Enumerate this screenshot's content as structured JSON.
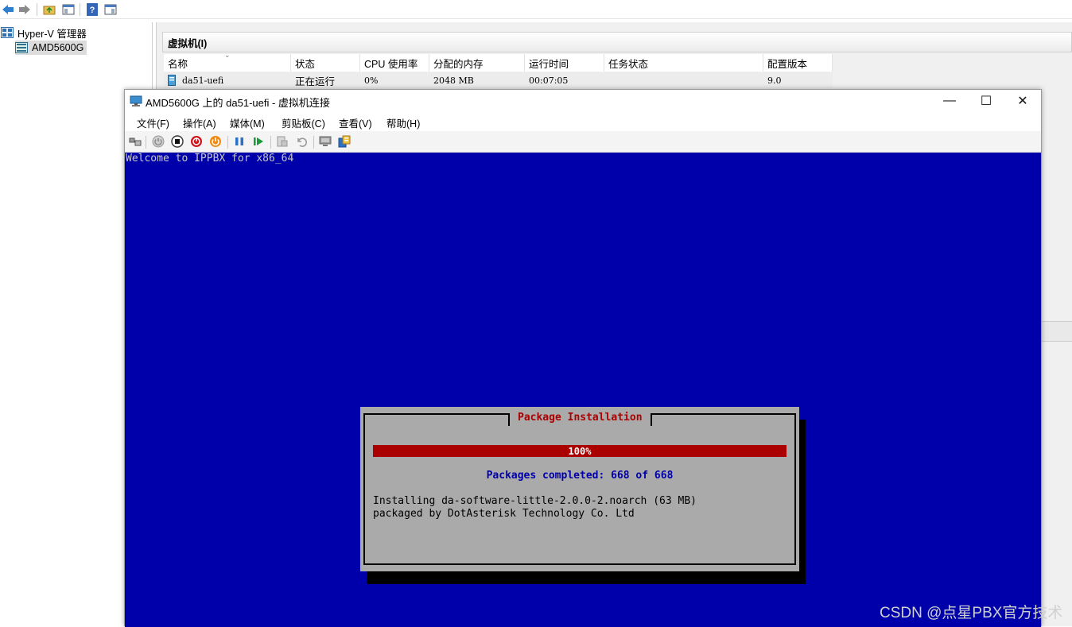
{
  "manager": {
    "tree": {
      "root_label": "Hyper-V 管理器",
      "child_label": "AMD5600G"
    },
    "vm_section_title": "虚拟机(I)",
    "columns": [
      {
        "label": "名称"
      },
      {
        "label": "状态"
      },
      {
        "label": "CPU 使用率"
      },
      {
        "label": "分配的内存"
      },
      {
        "label": "运行时间"
      },
      {
        "label": "任务状态"
      },
      {
        "label": "配置版本"
      }
    ],
    "vm_row": {
      "name": "da51-uefi",
      "state": "正在运行",
      "cpu": "0%",
      "memory": "2048 MB",
      "uptime": "00:07:05",
      "task": "",
      "version": "9.0"
    },
    "toolbar_icons": [
      "back-arrow-icon",
      "forward-arrow-icon",
      "folder-up-icon",
      "show-hide-pane-icon",
      "help-icon",
      "action-pane-icon"
    ]
  },
  "vm_window": {
    "title": "AMD5600G 上的 da51-uefi - 虚拟机连接",
    "controls": {
      "minimize": "—",
      "maximize": "☐",
      "close": "✕"
    },
    "menu": [
      "文件(F)",
      "操作(A)",
      "媒体(M)",
      "剪贴板(C)",
      "查看(V)",
      "帮助(H)"
    ],
    "toolbar_icons": [
      "ctrl-alt-del-icon",
      "start-icon",
      "turn-off-icon",
      "shutdown-icon",
      "save-icon",
      "pause-icon",
      "resume-icon",
      "checkpoint-icon",
      "revert-icon",
      "enhanced-session-icon",
      "share-icon"
    ]
  },
  "console": {
    "welcome": "Welcome to IPPBX for x86_64",
    "dialog": {
      "title": "Package Installation",
      "progress_label": "100%",
      "progress_fraction": 1.0,
      "packages_completed": "Packages completed: 668 of 668",
      "line1": "Installing da-software-little-2.0.0-2.noarch (63 MB)",
      "line2": "packaged by DotAsterisk Technology Co. Ltd"
    }
  },
  "watermark": "CSDN @点星PBX官方技术",
  "colors": {
    "console_bg": "#0000aa",
    "dialog_bg": "#aaaaaa",
    "progress": "#aa0000",
    "dialog_title": "#aa0000",
    "count_text": "#0000aa"
  }
}
